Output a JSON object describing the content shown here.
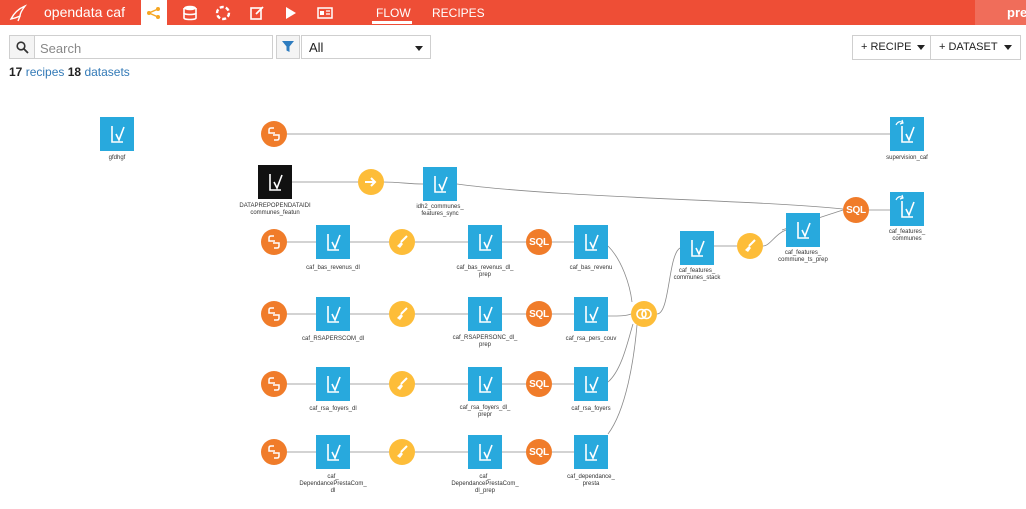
{
  "header": {
    "project_name": "opendata caf",
    "nav_flow": "FLOW",
    "nav_recipes": "RECIPES",
    "right_text": "pre",
    "brand_color": "#ee4e36"
  },
  "search": {
    "placeholder": "Search"
  },
  "filter": {
    "selected": "All"
  },
  "summary": {
    "recipes_count": "17",
    "recipes_label": "recipes",
    "datasets_count": "18",
    "datasets_label": "datasets"
  },
  "actions": {
    "recipe_label": "+ RECIPE",
    "dataset_label": "+ DATASET"
  },
  "flow": {
    "labels": {
      "gfdhgf": "gfdhgf",
      "datapre": "DATAPREPOPENDATAIDI\ncommunes_featun",
      "idh2": "idh2_communes_\nfeatures_sync",
      "supervision": "supervision_caf",
      "caf_features_communes": "caf_features_\ncommunes",
      "features_stack": "caf_features_\ncommunes_stack",
      "features_prep": "caf_features_\ncommune_ts_prep",
      "bas_revenus_dl": "caf_bas_revenus_dl",
      "bas_revenus_dl_prep": "caf_bas_revenus_dl_\nprep",
      "bas_revenus": "caf_bas_revenu",
      "rsapers_dl": "caf_RSAPERSCOM_dl",
      "rsapers_prep": "caf_RSAPERSONC_dl_\nprep",
      "rsa_pers": "caf_rsa_pers_couv",
      "rsa_foyers_dl": "caf_rsa_foyers_dl",
      "rsa_foyers_prep": "caf_rsa_foyers_dl_\nprepr",
      "rsa_foyers": "caf_rsa_foyers",
      "dep_dl": "caf_\nDependancePrestaCom_\ndl",
      "dep_prep": "caf_\nDependancePrestaCom_\ndl_prep",
      "dep": "caf_dependance_\npresta"
    },
    "sql_label": "SQL",
    "colors": {
      "dataset": "#28a9dd",
      "python": "#f07c2a",
      "prepare": "#fdbd39",
      "stack": "#fdbd39"
    }
  }
}
